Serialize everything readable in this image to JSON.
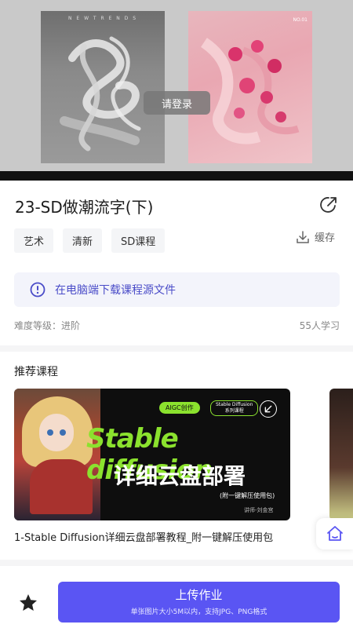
{
  "hero": {
    "login_label": "请登录",
    "poster_left_caption": "N E W   T R E N D S",
    "poster_right_tag": "NO.01"
  },
  "course": {
    "title": "23-SD做潮流字(下)",
    "tags": [
      "艺术",
      "清新",
      "SD课程"
    ],
    "cache_label": "缓存",
    "notice": "在电脑端下载课程源文件",
    "difficulty": "难度等级：进阶",
    "learners": "55人学习"
  },
  "recommend": {
    "section_title": "推荐课程",
    "card": {
      "badge": "AIGC创作",
      "series_line1": "Stable Diffusion",
      "series_line2": "系列课程",
      "headline": "Stable diffusion",
      "headline_cn": "详细云盘部署",
      "subline": "(附一键解压使用包)",
      "teacher": "讲师-刘金宫",
      "caption": "1-Stable Diffusion详细云盘部署教程_附一键解压使用包"
    }
  },
  "bottom": {
    "upload_label": "上传作业",
    "upload_hint": "单张图片大小5M以内，支持JPG、PNG格式"
  },
  "colors": {
    "accent": "#5a55f3",
    "notice_text": "#4a4cc8",
    "green": "#8be22e"
  },
  "icons": [
    "share-icon",
    "download-icon",
    "info-icon",
    "home-icon",
    "star-icon",
    "arrow-icon"
  ]
}
